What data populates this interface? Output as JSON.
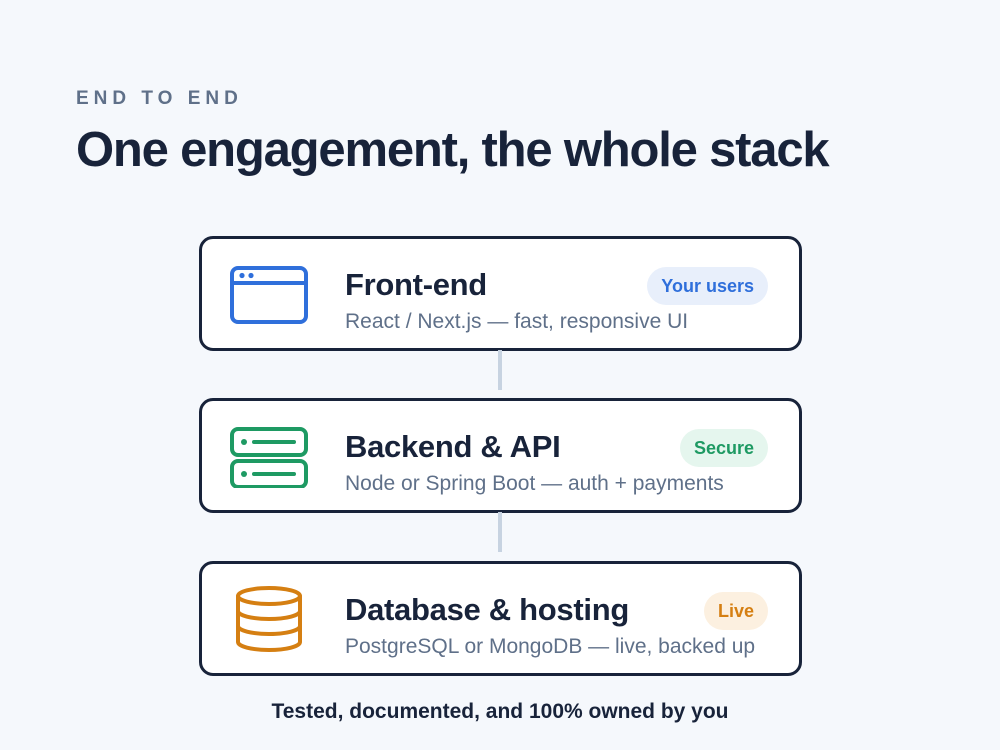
{
  "header": {
    "eyebrow": "END TO END",
    "title": "One engagement, the whole stack"
  },
  "layers": [
    {
      "name": "Front-end",
      "description": "React / Next.js — fast, responsive UI",
      "badge": "Your users",
      "icon": "browser-window-icon",
      "color": "#2f6fdb"
    },
    {
      "name": "Backend & API",
      "description": "Node or Spring Boot — auth + payments",
      "badge": "Secure",
      "icon": "server-icon",
      "color": "#1e9a63"
    },
    {
      "name": "Database & hosting",
      "description": "PostgreSQL or MongoDB — live, backed up",
      "badge": "Live",
      "icon": "database-icon",
      "color": "#d57f12"
    }
  ],
  "footer": "Tested, documented, and 100% owned by you"
}
